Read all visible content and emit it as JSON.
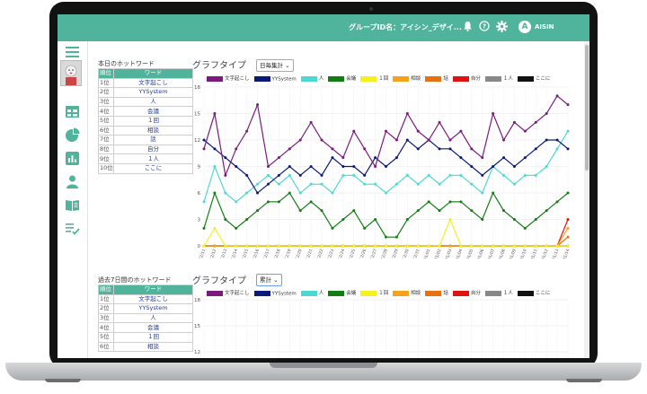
{
  "header": {
    "group_label": "グループID名：アイシン_デザイ...",
    "user_initial": "A",
    "user_name": "AISIN"
  },
  "header_icons": [
    "bell-icon",
    "help-icon",
    "gear-icon"
  ],
  "sidebar_icons": [
    "menu-icon",
    "user-photo",
    "table-icon",
    "pie-chart-icon",
    "bar-chart-icon",
    "person-icon",
    "book-icon",
    "checklist-icon"
  ],
  "today": {
    "title": "本日のホットワード",
    "header": [
      "順位",
      "ワード"
    ],
    "rows": [
      [
        "1位",
        "文字起こし"
      ],
      [
        "2位",
        "YYSystem"
      ],
      [
        "3位",
        "人"
      ],
      [
        "4位",
        "会議"
      ],
      [
        "5位",
        "１回"
      ],
      [
        "6位",
        "相談"
      ],
      [
        "7位",
        "話"
      ],
      [
        "8位",
        "自分"
      ],
      [
        "9位",
        "１人"
      ],
      [
        "10位",
        "ここに"
      ]
    ],
    "graph_type_label": "グラフタイプ",
    "select_value": "日毎集計"
  },
  "week": {
    "title": "過去7日間のホットワード",
    "header": [
      "順位",
      "ワード"
    ],
    "rows": [
      [
        "1位",
        "文字起こし"
      ],
      [
        "2位",
        "YYSystem"
      ],
      [
        "3位",
        "人"
      ],
      [
        "4位",
        "会議"
      ],
      [
        "5位",
        "１回"
      ],
      [
        "6位",
        "相談"
      ]
    ],
    "graph_type_label": "グラフタイプ",
    "select_value": "累計",
    "y_ticks": [
      18,
      15,
      12
    ]
  },
  "legend": [
    {
      "name": "文字起こし",
      "color": "#7b1a7e"
    },
    {
      "name": "YYSystem",
      "color": "#0b1a7a"
    },
    {
      "name": "人",
      "color": "#4dd9d0"
    },
    {
      "name": "会議",
      "color": "#137d14"
    },
    {
      "name": "１回",
      "color": "#f5f01e"
    },
    {
      "name": "相談",
      "color": "#f7a21b"
    },
    {
      "name": "話",
      "color": "#e8710f"
    },
    {
      "name": "自分",
      "color": "#e01212"
    },
    {
      "name": "１人",
      "color": "#888888"
    },
    {
      "name": "ここに",
      "color": "#111111"
    }
  ],
  "chart_data": {
    "type": "line",
    "ylim": [
      0,
      18
    ],
    "y_ticks": [
      0,
      3,
      6,
      9,
      12,
      15,
      18
    ],
    "x": [
      "12/11",
      "12/12",
      "12/13",
      "12/14",
      "12/15",
      "12/16",
      "12/17",
      "12/18",
      "12/19",
      "12/20",
      "12/21",
      "12/22",
      "12/23",
      "12/24",
      "12/25",
      "12/26",
      "12/27",
      "12/28",
      "12/29",
      "12/30",
      "12/31",
      "01/01",
      "01/02",
      "01/03",
      "01/04",
      "01/05",
      "01/06",
      "01/07",
      "01/08",
      "01/09",
      "01/10",
      "01/11",
      "01/12",
      "01/13",
      "01/14"
    ],
    "series": [
      {
        "name": "文字起こし",
        "color": "#7b1a7e",
        "values": [
          11,
          15,
          8,
          11,
          13,
          16,
          9,
          10,
          11,
          12,
          14,
          12,
          11,
          10,
          13,
          11,
          9,
          13,
          12,
          15,
          13,
          12,
          14,
          12,
          13,
          11,
          10,
          15,
          12,
          14,
          13,
          14,
          15,
          17,
          16
        ]
      },
      {
        "name": "YYSystem",
        "color": "#0b1a7a",
        "values": [
          12,
          11,
          10,
          9,
          8,
          6,
          7,
          8,
          9,
          8,
          9,
          8,
          10,
          9,
          9,
          8,
          10,
          9,
          10,
          12,
          11,
          12,
          11,
          11,
          10,
          9,
          8,
          9,
          10,
          9,
          10,
          11,
          12,
          12,
          11
        ]
      },
      {
        "name": "人",
        "color": "#4dd9d0",
        "values": [
          5,
          9,
          6,
          5,
          6,
          7,
          8,
          7,
          8,
          6,
          7,
          7,
          6,
          8,
          8,
          7,
          7,
          6,
          7,
          8,
          7,
          8,
          7,
          8,
          8,
          7,
          6,
          9,
          8,
          7,
          8,
          8,
          9,
          11,
          13
        ]
      },
      {
        "name": "会議",
        "color": "#137d14",
        "values": [
          2,
          6,
          3,
          2,
          3,
          4,
          5,
          5,
          6,
          4,
          5,
          4,
          2,
          3,
          4,
          2,
          3,
          1,
          1,
          3,
          4,
          5,
          4,
          5,
          5,
          4,
          3,
          6,
          4,
          3,
          2,
          3,
          4,
          5,
          6
        ]
      },
      {
        "name": "１回",
        "color": "#f5f01e",
        "values": [
          0,
          2,
          0,
          0,
          0,
          0,
          0,
          0,
          0,
          0,
          0,
          0,
          0,
          0,
          0,
          0,
          0,
          0,
          0,
          0,
          0,
          0,
          0,
          3,
          0,
          0,
          0,
          0,
          0,
          0,
          0,
          0,
          0,
          0,
          0
        ]
      },
      {
        "name": "相談",
        "color": "#f7a21b",
        "values": [
          0,
          0,
          0,
          0,
          0,
          0,
          0,
          0,
          0,
          0,
          0,
          0,
          0,
          0,
          0,
          0,
          0,
          0,
          0,
          0,
          0,
          0,
          0,
          0,
          0,
          0,
          0,
          0,
          0,
          0,
          0,
          0,
          0,
          0,
          2
        ]
      },
      {
        "name": "話",
        "color": "#e8710f",
        "values": [
          0,
          0,
          0,
          0,
          0,
          0,
          0,
          0,
          0,
          0,
          0,
          0,
          0,
          0,
          0,
          0,
          0,
          0,
          0,
          0,
          0,
          0,
          0,
          0,
          0,
          0,
          0,
          0,
          0,
          0,
          0,
          0,
          0,
          0,
          1
        ]
      },
      {
        "name": "自分",
        "color": "#e01212",
        "values": [
          0,
          0,
          0,
          0,
          0,
          0,
          0,
          0,
          0,
          0,
          0,
          0,
          0,
          0,
          0,
          0,
          0,
          0,
          0,
          0,
          0,
          0,
          0,
          0,
          0,
          0,
          0,
          0,
          0,
          0,
          0,
          0,
          0,
          0,
          3
        ]
      },
      {
        "name": "１人",
        "color": "#888888",
        "values": [
          0,
          0,
          0,
          0,
          0,
          0,
          0,
          0,
          0,
          0,
          0,
          0,
          0,
          0,
          0,
          0,
          0,
          0,
          0,
          0,
          0,
          0,
          0,
          0,
          0,
          0,
          0,
          0,
          0,
          0,
          0,
          0,
          0,
          0,
          0
        ]
      },
      {
        "name": "ここに",
        "color": "#111111",
        "values": [
          0,
          0,
          0,
          0,
          0,
          0,
          0,
          0,
          0,
          0,
          0,
          0,
          0,
          0,
          0,
          0,
          0,
          0,
          0,
          0,
          0,
          0,
          0,
          0,
          0,
          0,
          0,
          0,
          0,
          0,
          0,
          0,
          0,
          0,
          0
        ]
      }
    ]
  }
}
